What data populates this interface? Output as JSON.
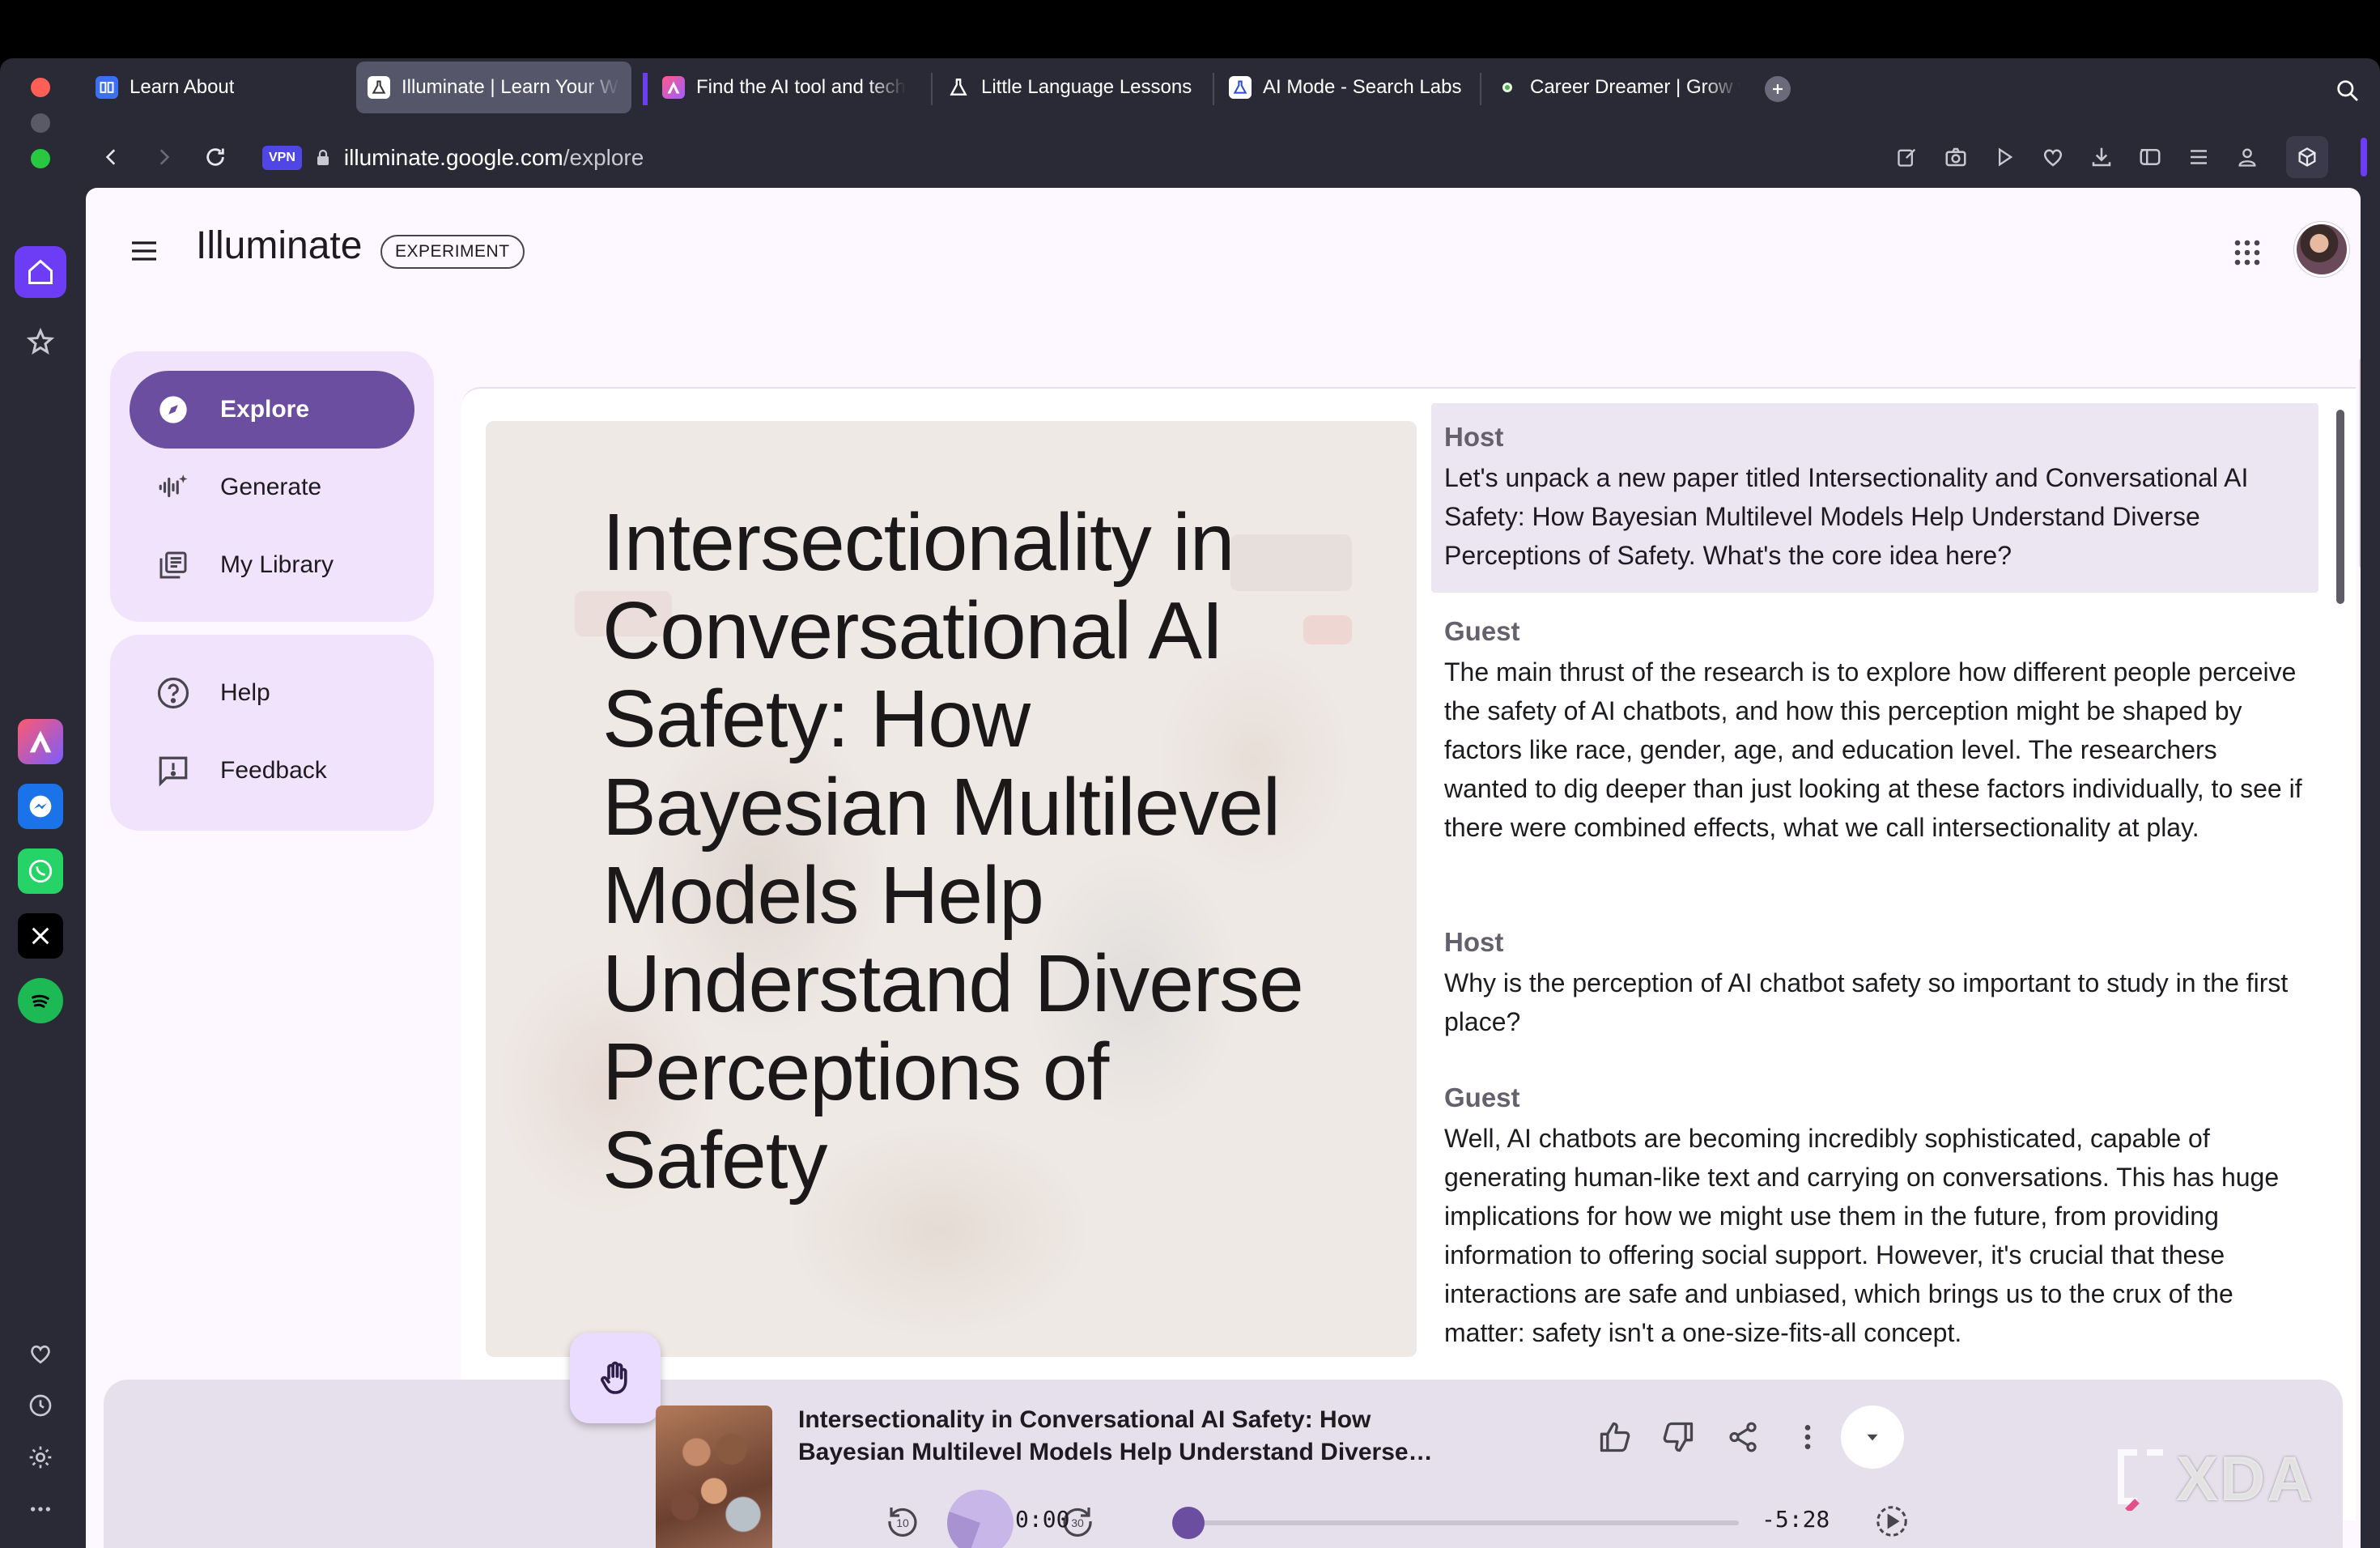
{
  "browser": {
    "tabs": [
      {
        "label": "Learn About",
        "favicon": "book-icon",
        "active": false
      },
      {
        "label": "Illuminate | Learn Your Way",
        "favicon": "flask-icon",
        "active": true
      },
      {
        "label": "Find the AI tool and tech",
        "favicon": "app-icon",
        "active": false
      },
      {
        "label": "Little Language Lessons",
        "favicon": "flask-icon",
        "active": false
      },
      {
        "label": "AI Mode - Search Labs",
        "favicon": "flask-icon",
        "active": false
      },
      {
        "label": "Career Dreamer | Grow with Google",
        "favicon": "dot-icon",
        "active": false
      }
    ],
    "vpn_label": "VPN",
    "url_host": "illuminate.google.com",
    "url_path": "/explore",
    "colors": {
      "chrome": "#2a2a36",
      "active_tab": "#55566a",
      "accent": "#4f46e5"
    }
  },
  "app": {
    "title": "Illuminate",
    "badge": "EXPERIMENT",
    "nav_primary": [
      {
        "label": "Explore",
        "icon": "compass-icon",
        "active": true
      },
      {
        "label": "Generate",
        "icon": "sparkle-waveform-icon",
        "active": false
      },
      {
        "label": "My Library",
        "icon": "library-icon",
        "active": false
      }
    ],
    "nav_secondary": [
      {
        "label": "Help",
        "icon": "help-circle-icon"
      },
      {
        "label": "Feedback",
        "icon": "feedback-icon"
      }
    ],
    "colors": {
      "accent": "#6c4ea0",
      "nav_card": "#f0e3fb",
      "page_bg": "#fdf7ff"
    }
  },
  "cover": {
    "title": "Intersectionality in Conversational AI Safety: How Bayesian Multilevel Models Help Understand Diverse Perceptions of Safety"
  },
  "transcript": [
    {
      "speaker": "Host",
      "text": "Let's unpack a new paper titled Intersectionality and Conversational AI Safety: How Bayesian Multilevel Models Help Understand Diverse Perceptions of Safety. What's the core idea here?"
    },
    {
      "speaker": "Guest",
      "text": "The main thrust of the research is to explore how different people perceive the safety of AI chatbots, and how this perception might be shaped by factors like race, gender, age, and education level. The researchers wanted to dig deeper than just looking at these factors individually, to see if there were combined effects, what we call intersectionality at play."
    },
    {
      "speaker": "Host",
      "text": "Why is the perception of AI chatbot safety so important to study in the first place?"
    },
    {
      "speaker": "Guest",
      "text": "Well, AI chatbots are becoming incredibly sophisticated, capable of generating human-like text and carrying on conversations. This has huge implications for how we might use them in the future, from providing information to offering social support. However, it's crucial that these interactions are safe and unbiased, which brings us to the crux of the matter: safety isn't a one-size-fits-all concept."
    }
  ],
  "player": {
    "title": "Intersectionality in Conversational AI Safety: How Bayesian Multilevel Models Help Understand Diverse Perceptions of Safety",
    "elapsed": "0:00",
    "remaining": "-5:28",
    "progress": 0.0,
    "rewind_label": "10",
    "forward_label": "30"
  },
  "watermark": {
    "text": "XDA"
  }
}
